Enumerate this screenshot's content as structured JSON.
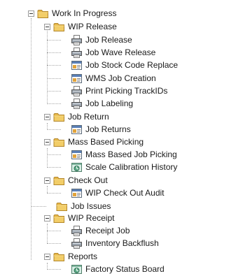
{
  "tree": {
    "work_in_progress": "Work In Progress",
    "wip_release": "WIP Release",
    "job_release": "Job Release",
    "job_wave_release": "Job Wave Release",
    "job_stock_code_replace": "Job Stock Code Replace",
    "wms_job_creation": "WMS Job Creation",
    "print_picking_trackids": "Print Picking TrackIDs",
    "job_labeling": "Job Labeling",
    "job_return": "Job Return",
    "job_returns": "Job Returns",
    "mass_based_picking": "Mass Based Picking",
    "mass_based_job_picking": "Mass Based Job Picking",
    "scale_calibration_history": "Scale Calibration History",
    "check_out": "Check Out",
    "wip_check_out_audit": "WIP Check Out Audit",
    "job_issues": "Job Issues",
    "wip_receipt": "WIP Receipt",
    "receipt_job": "Receipt Job",
    "inventory_backflush": "Inventory Backflush",
    "reports": "Reports",
    "factory_status_board": "Factory Status Board"
  },
  "icons": {
    "folder": "folder-icon",
    "printer": "printer-icon",
    "form": "form-icon",
    "report": "report-icon"
  }
}
